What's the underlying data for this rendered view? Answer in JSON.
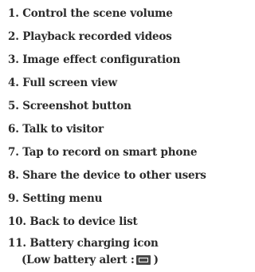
{
  "items": [
    "1. Control the scene volume",
    "2. Playback recorded videos",
    "3. Image effect configuration",
    "4. Full screen view",
    "5. Screenshot button",
    "6. Talk to visitor",
    "7. Tap to record  on smart phone",
    "8. Share the device to other users",
    "9. Setting menu",
    "10. Back to device list",
    "11. Battery charging icon"
  ],
  "note": {
    "prefix": "(Low battery alert :",
    "icon": "battery-low-icon",
    "suffix": ")"
  }
}
